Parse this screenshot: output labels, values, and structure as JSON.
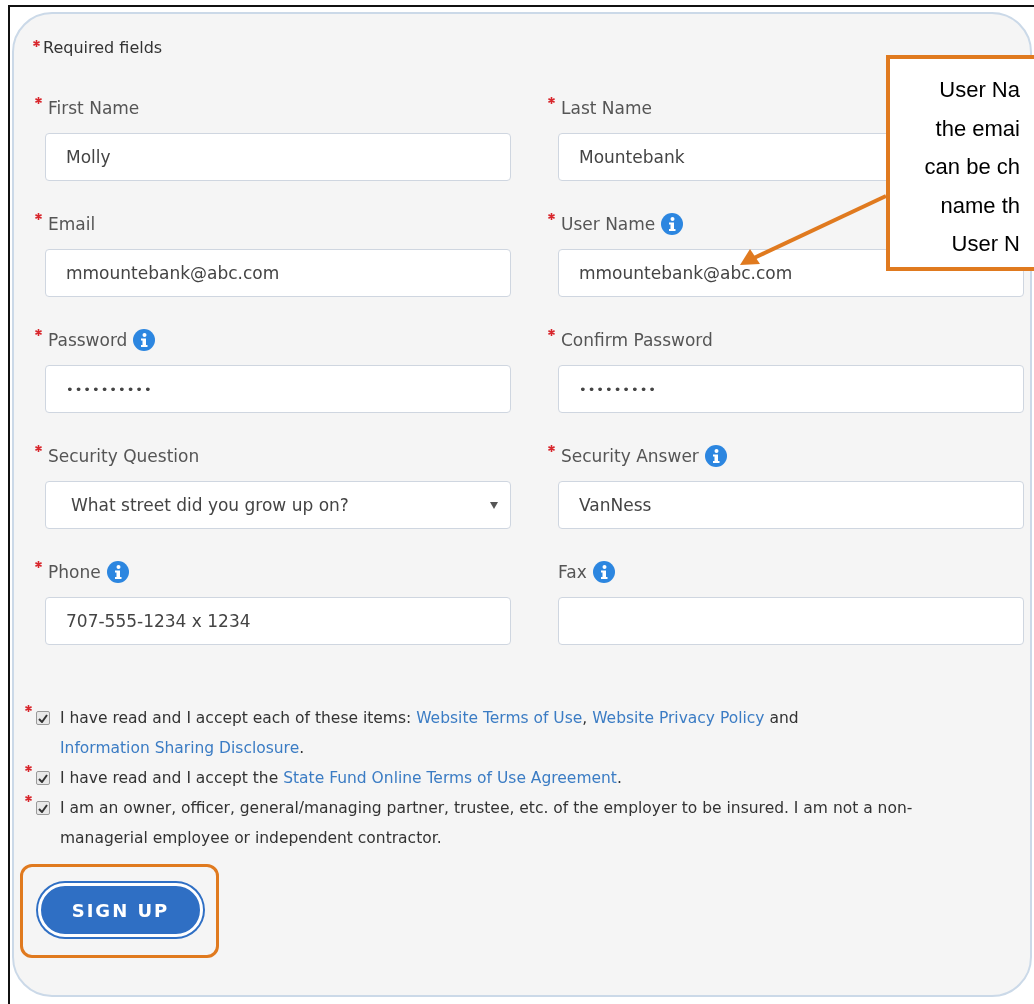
{
  "required_note": {
    "text": "Required fields",
    "required": true
  },
  "fields": [
    {
      "label": "First Name",
      "required": true,
      "info": false,
      "kind": "text",
      "value": "Molly"
    },
    {
      "label": "Last Name",
      "required": true,
      "info": false,
      "kind": "text",
      "value": "Mountebank"
    },
    {
      "label": "Email",
      "required": true,
      "info": false,
      "kind": "text",
      "value": "mmountebank@abc.com"
    },
    {
      "label": "User Name",
      "required": true,
      "info": true,
      "kind": "text",
      "value": "mmountebank@abc.com"
    },
    {
      "label": "Password",
      "required": true,
      "info": true,
      "kind": "password",
      "value": "••••••••••"
    },
    {
      "label": "Confirm Password",
      "required": true,
      "info": false,
      "kind": "password",
      "value": "•••••••••"
    },
    {
      "label": "Security Question",
      "required": true,
      "info": false,
      "kind": "select",
      "value": "What street did you grow up on?"
    },
    {
      "label": "Security Answer",
      "required": true,
      "info": true,
      "kind": "text",
      "value": "VanNess"
    },
    {
      "label": "Phone",
      "required": true,
      "info": true,
      "kind": "text",
      "value": "707-555-1234 x 1234"
    },
    {
      "label": "Fax",
      "required": false,
      "info": true,
      "kind": "text"
    }
  ],
  "agreements": [
    {
      "required": true,
      "checked": true,
      "parts": [
        {
          "kind": "text",
          "text": "I have read and I accept each of these items: "
        },
        {
          "kind": "link",
          "text": "Website Terms of Use"
        },
        {
          "kind": "text",
          "text": ", "
        },
        {
          "kind": "link",
          "text": "Website Privacy Policy"
        },
        {
          "kind": "text",
          "text": " and "
        },
        {
          "kind": "link",
          "text": "Information Sharing Disclosure"
        },
        {
          "kind": "text",
          "text": "."
        }
      ]
    },
    {
      "required": true,
      "checked": true,
      "parts": [
        {
          "kind": "text",
          "text": "I have read and I accept the "
        },
        {
          "kind": "link",
          "text": "State Fund Online Terms of Use Agreement"
        },
        {
          "kind": "text",
          "text": "."
        }
      ]
    },
    {
      "required": true,
      "checked": true,
      "parts": [
        {
          "kind": "text",
          "text": "I am an owner, officer, general/managing partner, trustee, etc. of the employer to be insured. I am not a non-managerial employee or independent contractor."
        }
      ]
    }
  ],
  "signup_button": {
    "label": "SIGN UP",
    "highlighted": true
  },
  "callout": {
    "lines": [
      "User Na",
      "the emai",
      "can be ch",
      "name th",
      "User N"
    ]
  }
}
